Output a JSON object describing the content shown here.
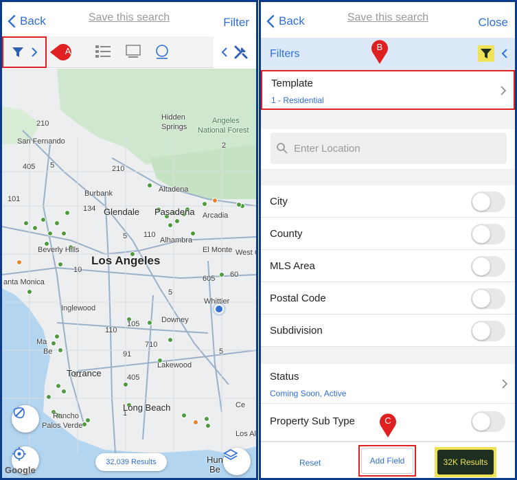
{
  "left": {
    "header": {
      "back": "Back",
      "title": "Save this search",
      "action": "Filter"
    },
    "marker_a": "A",
    "map": {
      "places": {
        "hidden": "Hidden",
        "springs": "Springs",
        "angeles": "Angeles",
        "national_forest": "National Forest",
        "san_fernando": "San Fernando",
        "burbank": "Burbank",
        "altadena": "Altadena",
        "glendale": "Glendale",
        "pasadena": "Pasadena",
        "arcadia": "Arcadia",
        "alhambra": "Alhambra",
        "beverly_hills": "Beverly Hills",
        "el_monte": "El Monte",
        "west_c": "West C",
        "los_angeles": "Los Angeles",
        "santa_monica": "anta Monica",
        "inglewood": "Inglewood",
        "whittier": "Whittier",
        "downey": "Downey",
        "manhattan": "Ma",
        "beach_m": "Be",
        "torrance": "Torrance",
        "lakewood": "Lakewood",
        "long_beach": "Long Beach",
        "rancho": "Rancho",
        "palos_verdes": "Palos Verde",
        "ce": "Ce",
        "los_al": "Los Al",
        "hun": "Hun",
        "be_r": "Be"
      },
      "shields": {
        "s210": "210",
        "s405": "405",
        "s5": "5",
        "s210b": "210",
        "s2": "2",
        "s134": "134",
        "s101": "101",
        "s110": "110",
        "s5b": "5",
        "s10": "10",
        "s605": "605",
        "s60": "60",
        "s5c": "5",
        "s105": "105",
        "s110b": "110",
        "s710": "710",
        "s91": "91",
        "s91b": "91",
        "s5d": "5",
        "s405b": "405",
        "s1": "1"
      },
      "results": "32,039 Results",
      "attribution": "Google"
    }
  },
  "right": {
    "header": {
      "back": "Back",
      "title": "Save this search",
      "action": "Close"
    },
    "filters_label": "Filters",
    "marker_b": "B",
    "template": {
      "title": "Template",
      "value": "1 - Residential"
    },
    "location_placeholder": "Enter Location",
    "toggles": [
      {
        "label": "City",
        "on": false
      },
      {
        "label": "County",
        "on": false
      },
      {
        "label": "MLS Area",
        "on": false
      },
      {
        "label": "Postal Code",
        "on": false
      },
      {
        "label": "Subdivision",
        "on": false
      }
    ],
    "status": {
      "title": "Status",
      "value": "Coming Soon, Active"
    },
    "property_sub_type": "Property Sub Type",
    "marker_c": "C",
    "footer": {
      "reset": "Reset",
      "add_field": "Add Field",
      "results": "32K Results"
    }
  },
  "colors": {
    "accent": "#2f6fd6",
    "highlight": "#f0e35a",
    "annotation": "#e02020",
    "frame": "#0a3a8a",
    "listing_green": "#4f9a3d",
    "listing_orange": "#e8862a"
  }
}
